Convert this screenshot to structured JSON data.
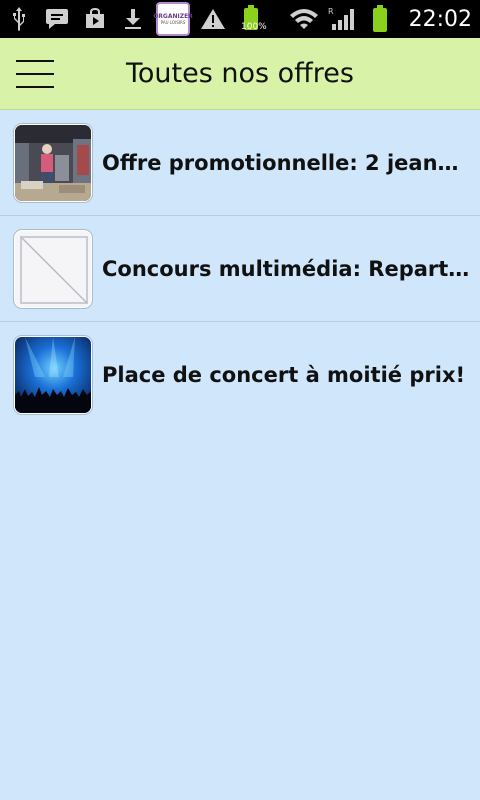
{
  "status_bar": {
    "time": "22:02",
    "battery_percent_label": "100%",
    "notification_icons": [
      "usb-icon",
      "message-icon",
      "shop-icon",
      "download-icon",
      "app-thumbnail-icon",
      "warning-icon",
      "battery-charging-icon"
    ],
    "app_thumbnail": {
      "line1": "ORGANIZER",
      "line2": "PAU LOISIRS"
    },
    "system_icons": [
      "wifi-icon",
      "signal-icon",
      "battery-icon"
    ]
  },
  "app_bar": {
    "title": "Toutes nos offres",
    "menu_icon": "hamburger-menu-icon",
    "background": "#d8f3a8"
  },
  "offers": [
    {
      "title": "Offre promotionnelle: 2 jeans …",
      "thumbnail": "store-photo"
    },
    {
      "title": "Concours multimédia: Reparte…",
      "thumbnail": "placeholder-image"
    },
    {
      "title": "Place de concert à moitié prix!",
      "thumbnail": "concert-photo"
    }
  ],
  "colors": {
    "background": "#cfe6fb",
    "status_bar": "#000000",
    "battery_green": "#8cd01e"
  }
}
